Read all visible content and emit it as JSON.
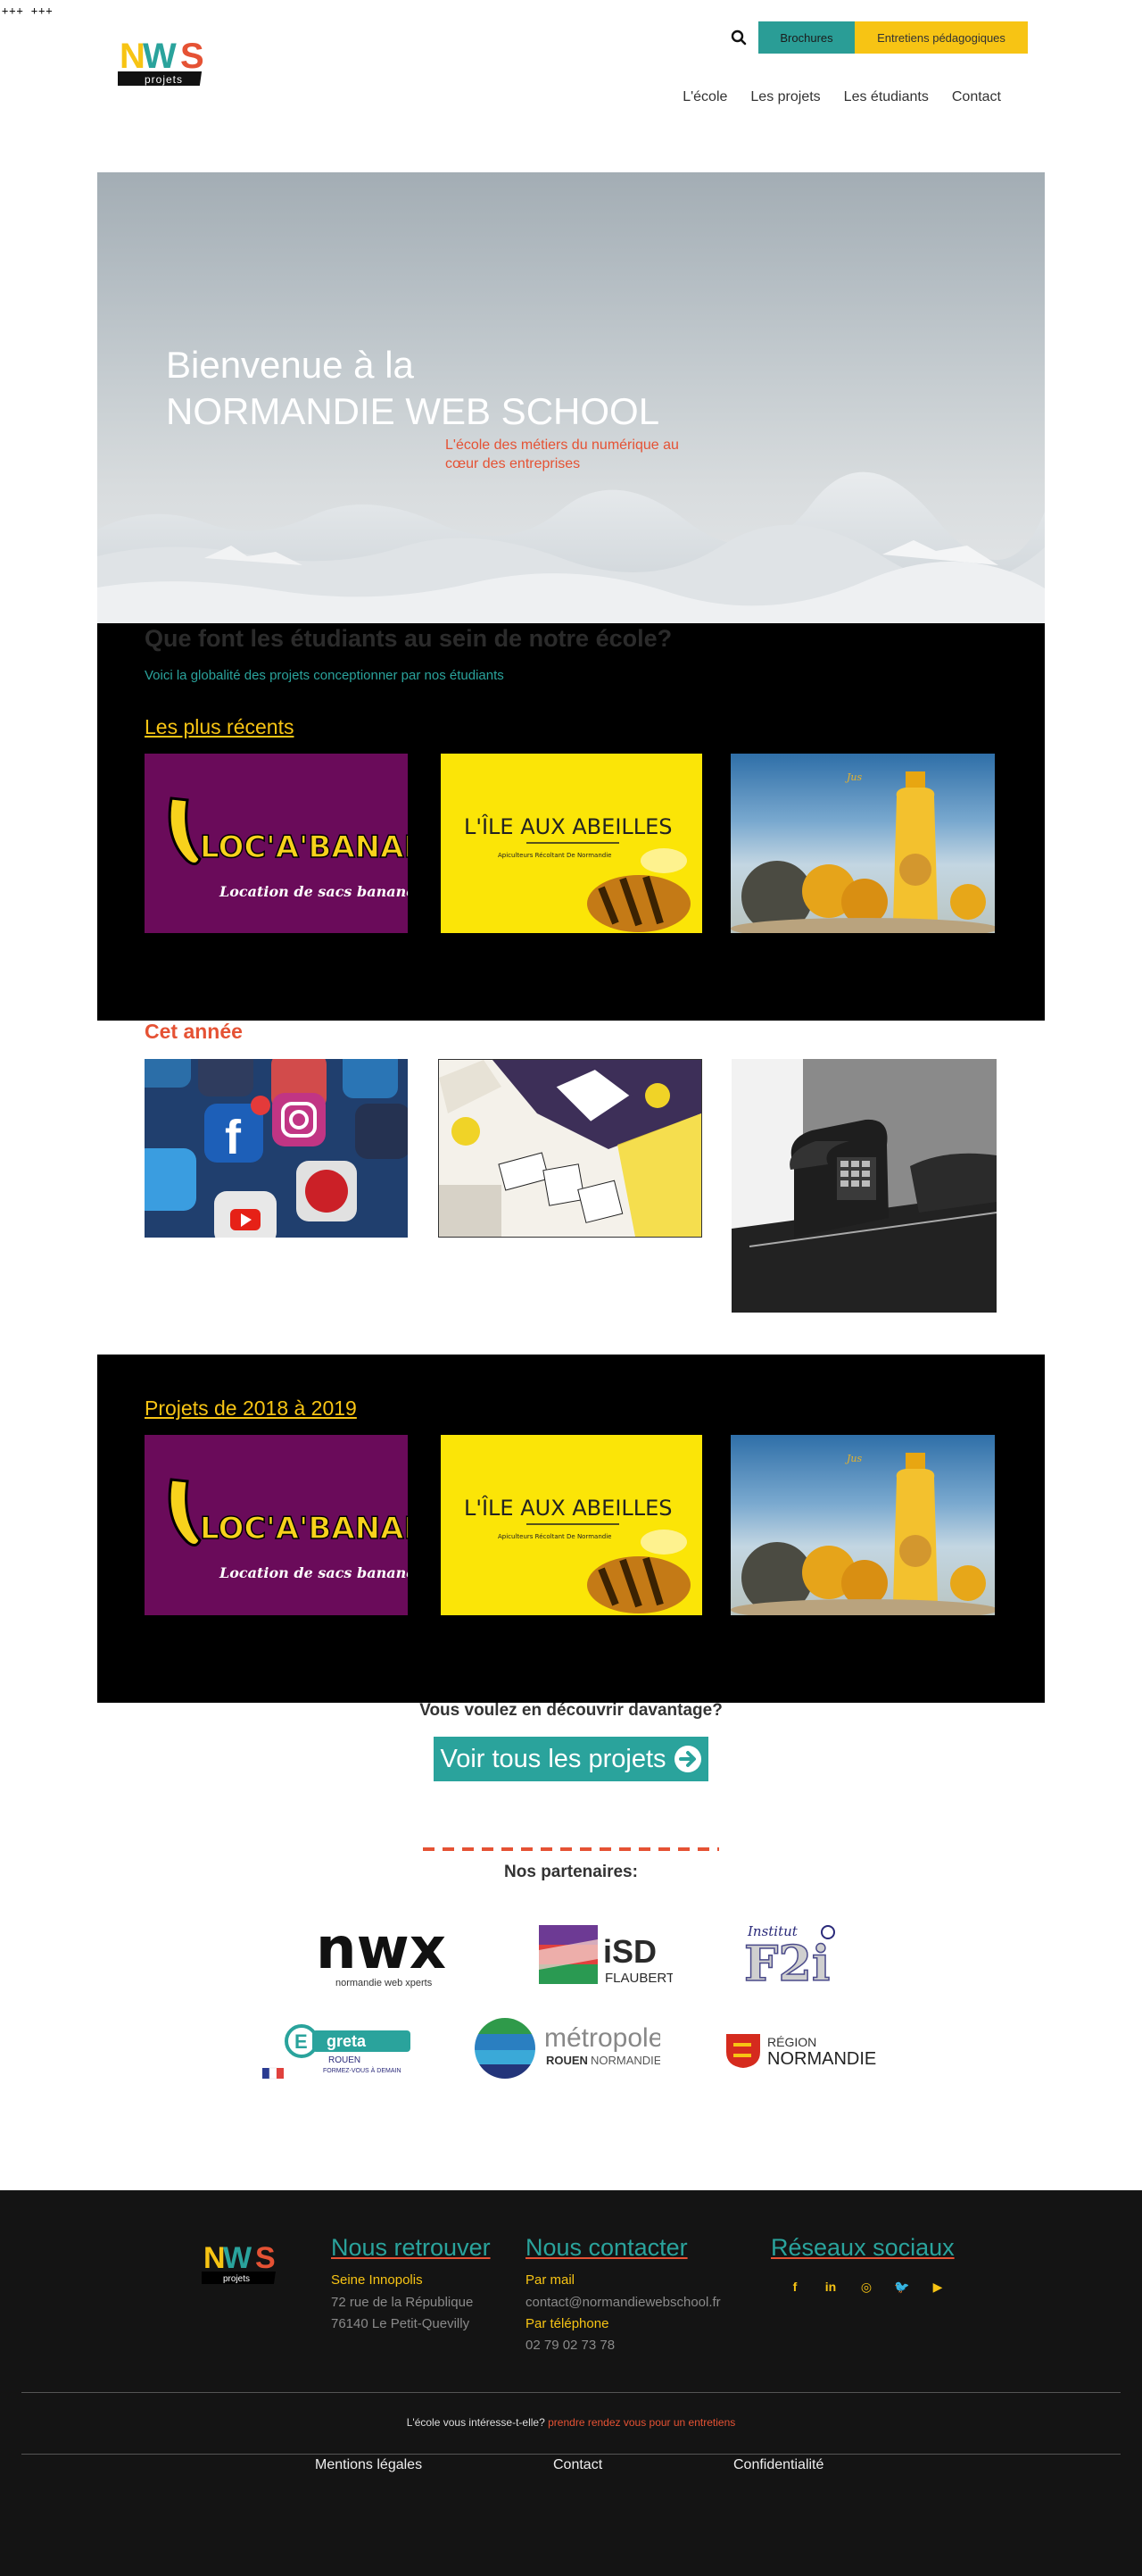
{
  "top_marks": "+++ +++",
  "header": {
    "logo_text": "NWS",
    "logo_sub": "projets",
    "brochure_label": "Brochures",
    "entretiens_label": "Entretiens pédagogiques",
    "nav": [
      "L'école",
      "Les projets",
      "Les étudiants",
      "Contact"
    ]
  },
  "hero": {
    "title_line1": "Bienvenue à la",
    "title_line2": "NORMANDIE WEB SCHOOL",
    "subtitle_line1": "L'école des métiers du numérique au",
    "subtitle_line2": "cœur des entreprises"
  },
  "intro": {
    "title": "Que font les étudiants au sein de notre école?",
    "subtitle": "Voici la globalité des projets conceptionner par nos étudiants"
  },
  "sections": {
    "recents": "Les plus récents",
    "annee": "Cet année",
    "projets": "Projets de 2018 à 2019"
  },
  "projects": {
    "banane_title": "LOC'A'BANANE",
    "banane_sub": "Location de sacs banane",
    "abeilles_title": "L'ÎLE AUX ABEILLES",
    "abeilles_sub": "Apiculteurs Récoltant De Normandie"
  },
  "discover": {
    "title": "Vous voulez en découvrir davantage?",
    "button": "Voir tous les projets"
  },
  "partners": {
    "title": "Nos partenaires:",
    "nwx_name": "nwx",
    "nwx_sub": "normandie web xperts",
    "isd_name": "iSD",
    "isd_sub": "FLAUBERT",
    "f2i_sub": "Institut",
    "f2i_name": "F2i",
    "greta_name": "greta",
    "greta_sub1": "ROUEN",
    "greta_sub2": "FORMEZ-VOUS À DEMAIN",
    "metro_name": "métropole",
    "metro_sub1": "ROUEN",
    "metro_sub2": "NORMANDIE",
    "region_name1": "RÉGION",
    "region_name2": "NORMANDIE"
  },
  "footer": {
    "retrouver_title": "Nous retrouver",
    "retrouver_place": "Seine Innopolis",
    "retrouver_addr1": "72 rue de la République",
    "retrouver_addr2": "76140 Le Petit-Quevilly",
    "contacter_title": "Nous contacter",
    "mail_label": "Par mail",
    "mail_value": "contact@normandiewebschool.fr",
    "phone_label": "Par téléphone",
    "phone_value": "02 79 02 73 78",
    "social_title": "Réseaux sociaux",
    "social_icons": [
      "f",
      "in",
      "◎",
      "🐦",
      "▶"
    ],
    "cta_text": "L'école vous intéresse-t-elle?",
    "cta_link": "prendre rendez vous pour un entretiens",
    "links": [
      "Mentions légales",
      "Contact",
      "Confidentialité"
    ]
  },
  "colors": {
    "teal": "#2aa39c",
    "yellow": "#f7c414",
    "red": "#e55234",
    "footer_bg": "#141414"
  }
}
